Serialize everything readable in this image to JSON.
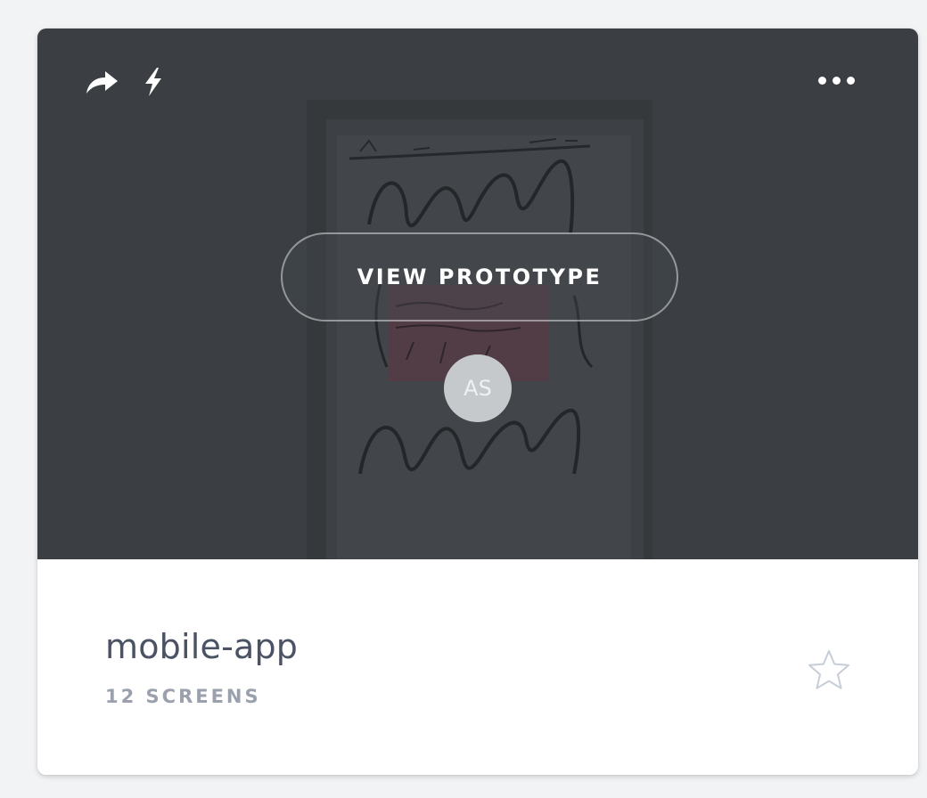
{
  "card": {
    "preview": {
      "view_prototype_label": "VIEW PROTOTYPE",
      "avatar_initials": "AS",
      "icons": {
        "share": "share-arrow-icon",
        "lightning": "lightning-bolt-icon",
        "more": "more-options-icon"
      }
    },
    "footer": {
      "title": "mobile-app",
      "screen_count": "12 SCREENS",
      "favorite_icon": "star-outline-icon"
    }
  },
  "colors": {
    "preview_bg": "#3b3f43",
    "title_text": "#4a5263",
    "meta_text": "#9aa1ad",
    "avatar_bg": "#c6c9cc",
    "star_outline": "#c8ced8"
  }
}
